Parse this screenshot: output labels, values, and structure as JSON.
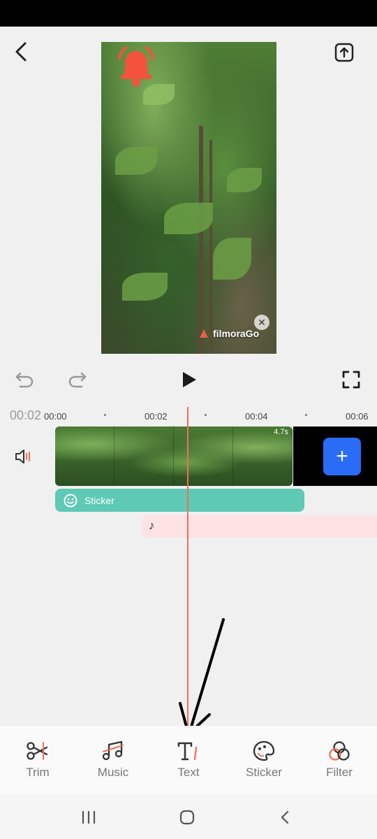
{
  "editor": {
    "watermark_text": "filmoraGo",
    "preview_close_glyph": "✕"
  },
  "timeline": {
    "current_time": "00:02",
    "ruler_labels": [
      "00:00",
      "00:02",
      "00:04",
      "00:06"
    ],
    "clip_duration": "4.7s",
    "add_glyph": "+",
    "sticker_track_label": "Sticker",
    "music_glyph": "♪"
  },
  "toolbar": {
    "items": [
      {
        "label": "Trim",
        "icon": "scissors-icon"
      },
      {
        "label": "Music",
        "icon": "music-note-icon"
      },
      {
        "label": "Text",
        "icon": "text-icon"
      },
      {
        "label": "Sticker",
        "icon": "sticker-icon"
      },
      {
        "label": "Filter",
        "icon": "filter-icon"
      }
    ]
  },
  "colors": {
    "accent": "#f36d5a",
    "add_button": "#2a6cf6",
    "sticker_track": "#5ec9b4",
    "music_track": "#fde3e4",
    "bell": "#f4523b"
  }
}
